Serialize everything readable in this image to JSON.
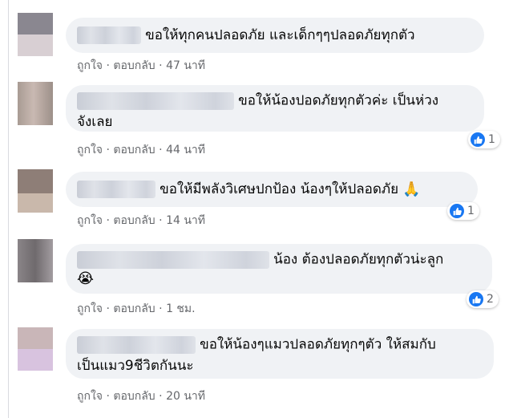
{
  "actions": {
    "like": "ถูกใจ",
    "sep": "·",
    "reply": "ตอบกลับ"
  },
  "like_icon": "thumbs-up-icon",
  "comments": [
    {
      "text": "ขอให้ทุกคนปลอดภัย และเด็กๆๆปลอดภัยทุกตัว",
      "time": "47 นาที",
      "reactions": ""
    },
    {
      "text": "ขอให้น้องปอดภัยทุกตัวค่ะ เป็นห่วง",
      "text2": "จังเลย",
      "time": "44 นาที",
      "reactions": "1"
    },
    {
      "text": "ขอให้มีพลังวิเศษปกป้อง น้องๆให้ปลอดภัย",
      "emoji": "🙏",
      "emoji_name": "praying-hands-icon",
      "time": "14 นาที",
      "reactions": "1"
    },
    {
      "text": "น้อง ต้องปลอดภัยทุกตัวน่ะลูก",
      "emoji": "😭",
      "emoji_name": "crying-face-icon",
      "time": "1 ชม.",
      "reactions": "2"
    },
    {
      "text": "ขอให้น้องๆแมวปลอดภัยทุกๆตัว ให้สมกับ",
      "text2": "เป็นแมว9ชีวิตกันนะ",
      "time": "20 นาที",
      "reactions": ""
    }
  ]
}
